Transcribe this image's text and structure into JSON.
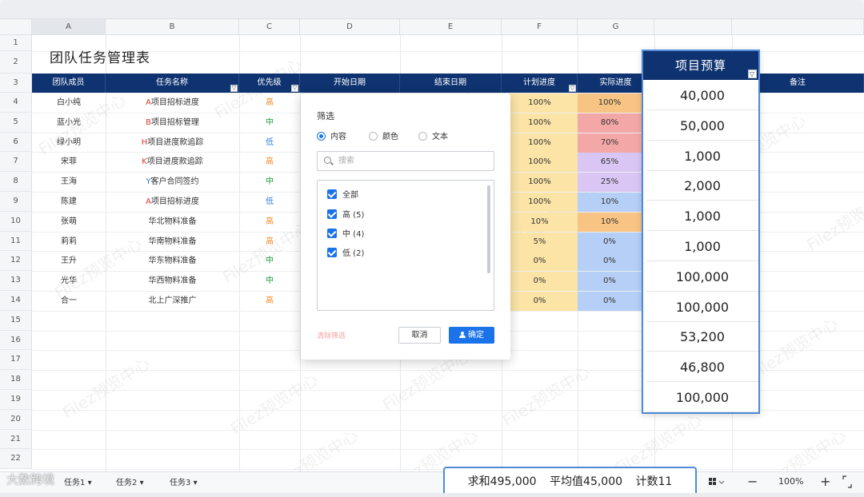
{
  "title": "团队任务管理表",
  "columns": [
    "A",
    "B",
    "C",
    "D",
    "E",
    "F",
    "G"
  ],
  "row_numbers": [
    "1",
    "2",
    "3",
    "4",
    "5",
    "6",
    "7",
    "8",
    "9",
    "10",
    "11",
    "12",
    "13",
    "14",
    "15",
    "16",
    "17",
    "18",
    "19",
    "20",
    "21",
    "22"
  ],
  "headers": {
    "member": "团队成员",
    "task": "任务名称",
    "priority": "优先级",
    "start": "开始日期",
    "end": "结束日期",
    "plan": "计划进度",
    "actual": "实际进度",
    "budget": "项目预算",
    "notes": "备注"
  },
  "filter_icon": "▽",
  "rows": [
    {
      "member": "白小纯",
      "prefix": "A",
      "task": "项目招标进度",
      "priority": "高",
      "plan": "100%",
      "actual": "100%"
    },
    {
      "member": "蓝小光",
      "prefix": "B",
      "task": "项目招标管理",
      "priority": "中",
      "plan": "100%",
      "actual": "80%"
    },
    {
      "member": "绿小明",
      "prefix": "H",
      "task": "项目进度款追踪",
      "priority": "低",
      "plan": "100%",
      "actual": "70%"
    },
    {
      "member": "宋菲",
      "prefix": "K",
      "task": "项目进度款追踪",
      "priority": "高",
      "plan": "100%",
      "actual": "65%"
    },
    {
      "member": "王海",
      "prefix": "Y",
      "task": "客户合同签约",
      "priority": "中",
      "plan": "100%",
      "actual": "25%"
    },
    {
      "member": "陈建",
      "prefix": "A",
      "task": "项目招标进度",
      "priority": "低",
      "plan": "100%",
      "actual": "10%"
    },
    {
      "member": "张萌",
      "prefix": "",
      "task": "华北物料准备",
      "priority": "高",
      "plan": "10%",
      "actual": "10%"
    },
    {
      "member": "莉莉",
      "prefix": "",
      "task": "华南物料准备",
      "priority": "高",
      "plan": "5%",
      "actual": "0%"
    },
    {
      "member": "王升",
      "prefix": "",
      "task": "华东物料准备",
      "priority": "中",
      "plan": "0%",
      "actual": "0%"
    },
    {
      "member": "光华",
      "prefix": "",
      "task": "华西物料准备",
      "priority": "中",
      "plan": "0%",
      "actual": "0%"
    },
    {
      "member": "合一",
      "prefix": "",
      "task": "北上广深推广",
      "priority": "高",
      "plan": "0%",
      "actual": "0%"
    }
  ],
  "colors": {
    "header_bg": "#0f3370",
    "accent": "#1a73e8",
    "plan_fill": "#fbe4a6",
    "actual_fills": [
      "#f7c483",
      "#f4a7a7",
      "#f4a7a7",
      "#d9c6f4",
      "#d9c6f4",
      "#b5cff6",
      "#f7c483",
      "#b5cff6",
      "#b5cff6",
      "#b5cff6",
      "#b5cff6"
    ]
  },
  "budget": [
    "40,000",
    "50,000",
    "1,000",
    "2,000",
    "1,000",
    "1,000",
    "100,000",
    "100,000",
    "53,200",
    "46,800",
    "100,000"
  ],
  "filter": {
    "title": "筛选",
    "radios": [
      {
        "label": "内容",
        "selected": true
      },
      {
        "label": "颜色",
        "selected": false
      },
      {
        "label": "文本",
        "selected": false
      }
    ],
    "search_placeholder": "搜索",
    "items": [
      "全部",
      "高 (5)",
      "中 (4)",
      "低 (2)"
    ],
    "clear_label": "清除筛选",
    "cancel_label": "取消",
    "ok_label": "确定"
  },
  "sheet_tabs": [
    "任务1",
    "任务2",
    "任务3"
  ],
  "tab_caret": "▾",
  "status": {
    "sum": "求和495,000",
    "avg": "平均值45,000",
    "count": "计数11"
  },
  "zoom": {
    "minus": "−",
    "value": "100%",
    "plus": "+"
  },
  "watermark": "Filez预览中心",
  "corner_logo": "大数跨境"
}
